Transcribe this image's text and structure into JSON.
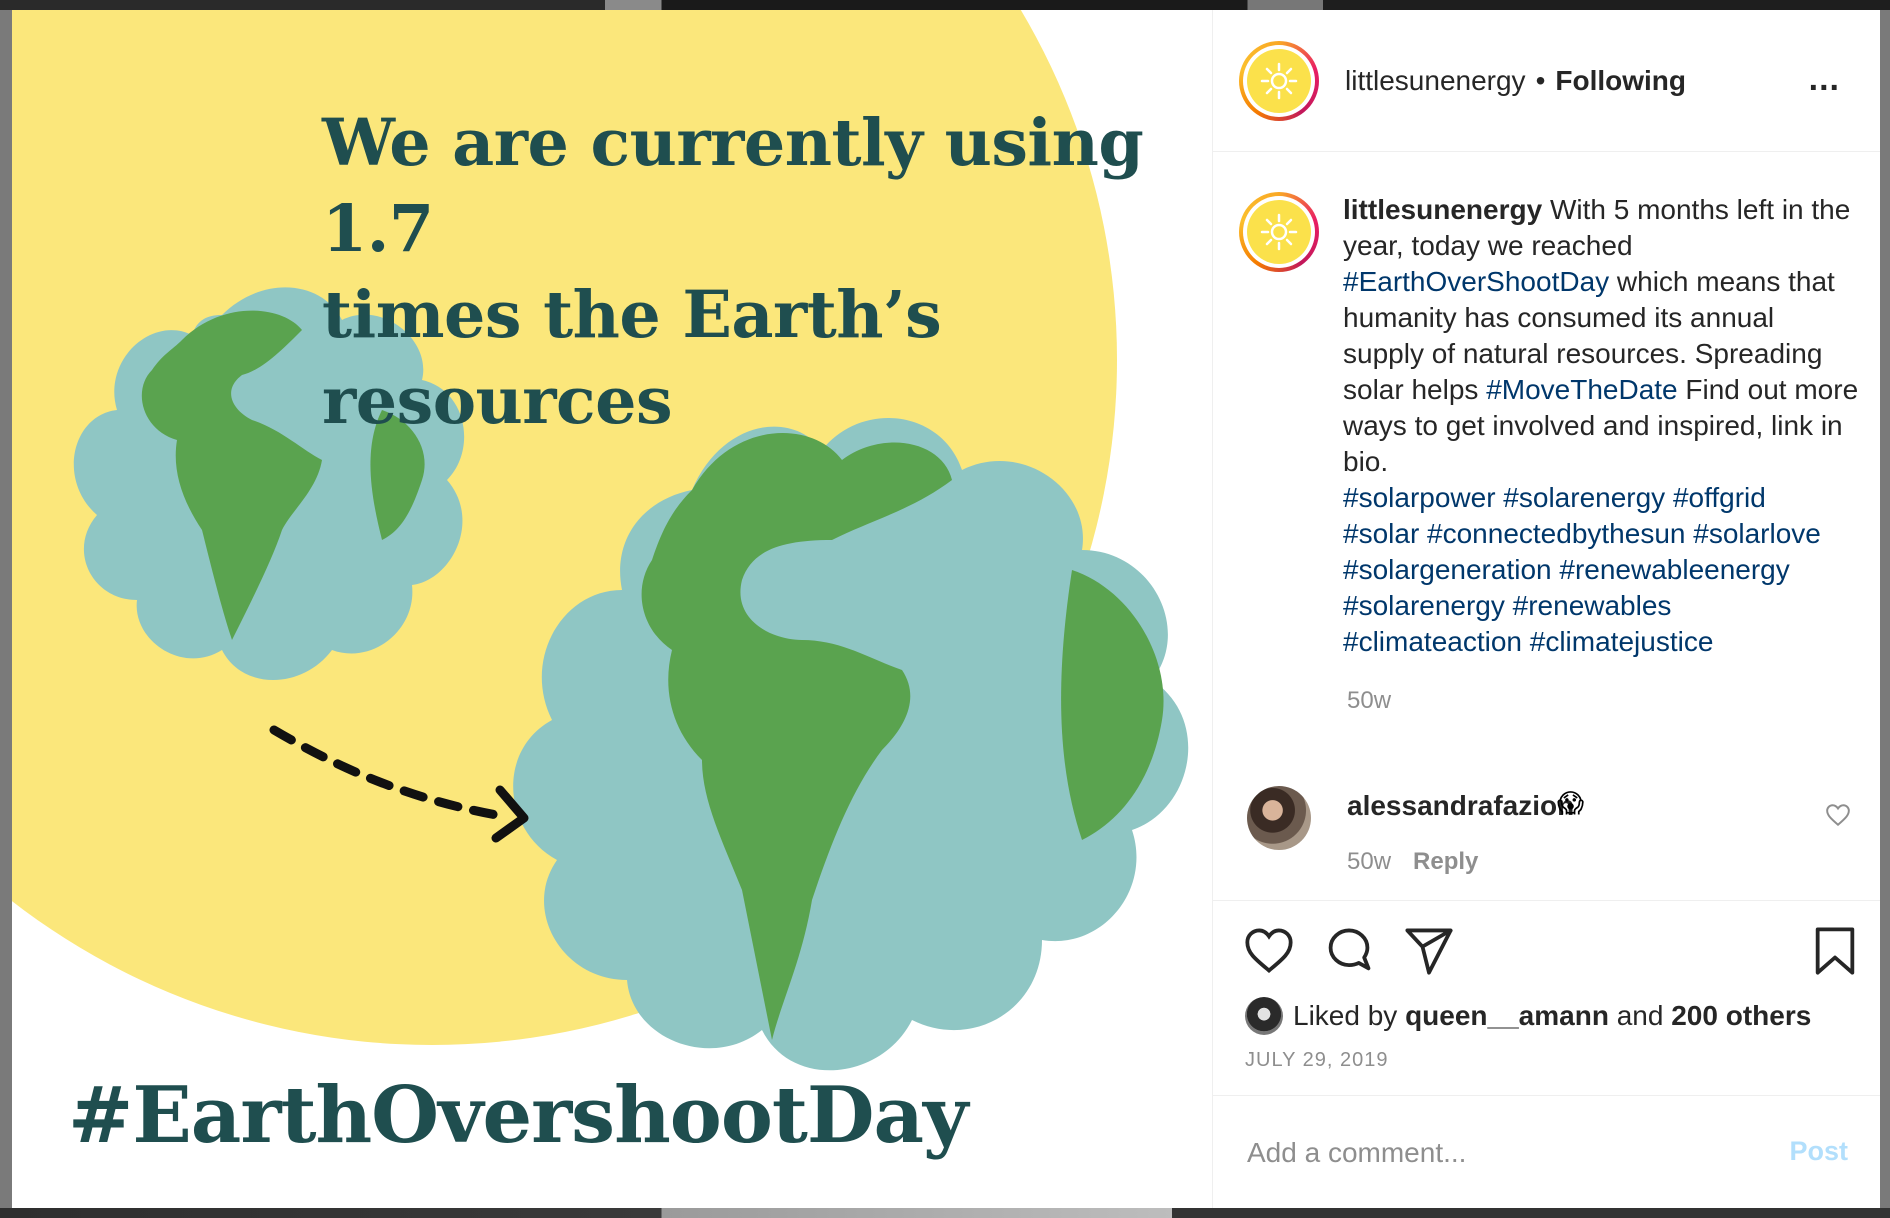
{
  "post": {
    "headline_line1": "We are currently using 1.7",
    "headline_line2": "times the Earth’s resources",
    "hashtag": "#EarthOvershootDay",
    "colors": {
      "sun": "#fbe77b",
      "ocean": "#8fc6c4",
      "land": "#5aa34f",
      "text": "#1f4e4f"
    }
  },
  "header": {
    "username": "littlesunenergy",
    "separator": "•",
    "follow_status": "Following",
    "more_label": "..."
  },
  "caption": {
    "username": "littlesunenergy",
    "part1": " With 5 months left in the year, today we reached ",
    "tag1": "#EarthOverShootDay",
    "part2": " which means that humanity has consumed its annual supply of natural resources. Spreading solar helps ",
    "tag2": "#MoveTheDate",
    "part3": " Find out more ways to get involved and inspired, link in bio.",
    "tags_line1": "#solarpower #solarenergy #offgrid",
    "tags_line2": "#solar #connectedbythesun #solarlove",
    "tags_line3": "#solargeneration #renewableenergy",
    "tags_line4": "#solarenergy #renewables",
    "tags_line5": "#climateaction #climatejustice",
    "time": "50w"
  },
  "comment": {
    "username": "alessandrafazion",
    "emoji": "😱",
    "time": "50w",
    "reply_label": "Reply"
  },
  "actions": {
    "liked_prefix": "Liked by ",
    "liked_user": "queen__amann",
    "liked_middle": " and ",
    "liked_others": "200 others",
    "date": "JULY 29, 2019"
  },
  "add_comment": {
    "placeholder": "Add a comment...",
    "post_label": "Post"
  }
}
